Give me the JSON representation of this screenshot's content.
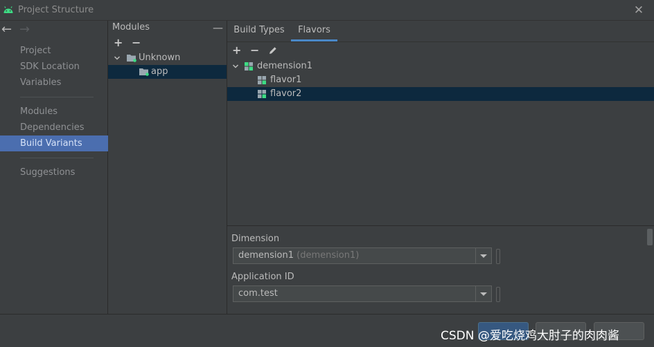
{
  "window": {
    "title": "Project Structure",
    "close_icon": "close-icon"
  },
  "nav": {
    "back_icon": "arrow-left-icon",
    "forward_icon": "arrow-right-icon",
    "groups": [
      [
        "Project",
        "SDK Location",
        "Variables"
      ],
      [
        "Modules",
        "Dependencies",
        "Build Variants"
      ],
      [
        "Suggestions"
      ]
    ],
    "selected": "Build Variants"
  },
  "modules": {
    "label": "Modules",
    "tree": [
      {
        "label": "Unknown",
        "icon": "folder-icon",
        "expanded": true,
        "level": 0
      },
      {
        "label": "app",
        "icon": "module-folder-icon",
        "level": 1,
        "selected": true
      }
    ]
  },
  "tabs": [
    {
      "label": "Build Types"
    },
    {
      "label": "Flavors",
      "active": true
    }
  ],
  "flavors_tree": [
    {
      "label": "demension1",
      "icon": "dimension-icon",
      "expanded": true,
      "level": 0
    },
    {
      "label": "flavor1",
      "icon": "flavor-icon",
      "level": 1
    },
    {
      "label": "flavor2",
      "icon": "flavor-icon",
      "level": 1,
      "selected": true
    }
  ],
  "details": {
    "dimension_label": "Dimension",
    "dimension_value": "demension1",
    "dimension_hint": "(demension1)",
    "app_id_label": "Application ID",
    "app_id_value": "com.test"
  },
  "watermark": "CSDN @爱吃烧鸡大肘子的肉肉酱",
  "colors": {
    "selection": "#4b6eaf",
    "tree_selection": "#0d293e",
    "tab_underline": "#4a88c7",
    "android_green": "#3ddc84"
  }
}
